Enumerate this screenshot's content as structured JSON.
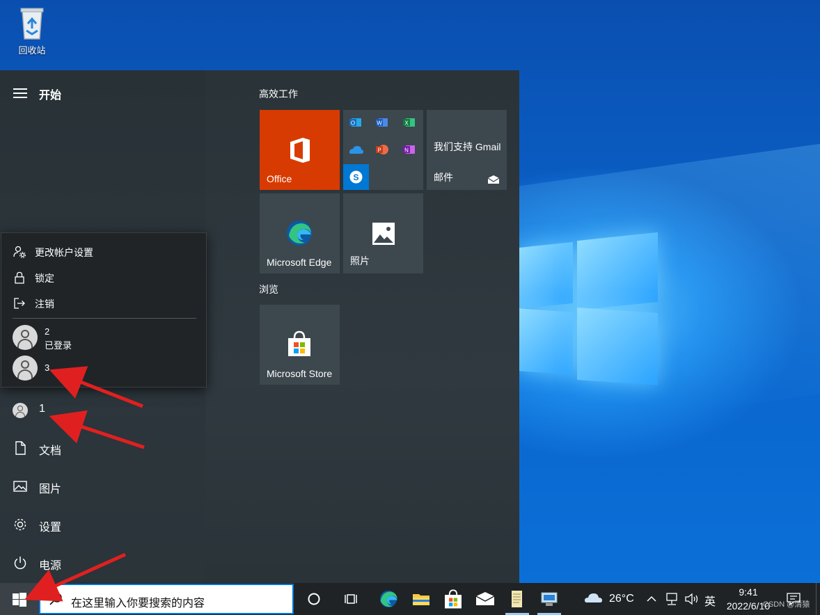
{
  "desktop": {
    "recycle_bin_label": "回收站"
  },
  "start_menu": {
    "title": "开始",
    "nav": {
      "user_label": "1",
      "documents": "文档",
      "pictures": "图片",
      "settings": "设置",
      "power": "电源"
    },
    "account_flyout": {
      "change_settings": "更改帐户设置",
      "lock": "锁定",
      "sign_out": "注销",
      "users": [
        {
          "name": "2",
          "status": "已登录"
        },
        {
          "name": "3",
          "status": ""
        }
      ]
    },
    "groups": [
      {
        "title": "高效工作"
      },
      {
        "title": "浏览"
      }
    ],
    "tiles": {
      "office": "Office",
      "mail_headline": "我们支持 Gmail",
      "mail": "邮件",
      "edge": "Microsoft Edge",
      "photos": "照片",
      "store": "Microsoft Store"
    }
  },
  "taskbar": {
    "search_placeholder": "在这里输入你要搜索的内容",
    "weather": "26°C",
    "ime": "英",
    "time": "9:41",
    "date": "2022/6/10",
    "watermark": "CSDN @清猿"
  },
  "colors": {
    "office_tile": "#d83b01",
    "accent": "#0078d7",
    "annotation_arrow": "#e02020"
  }
}
